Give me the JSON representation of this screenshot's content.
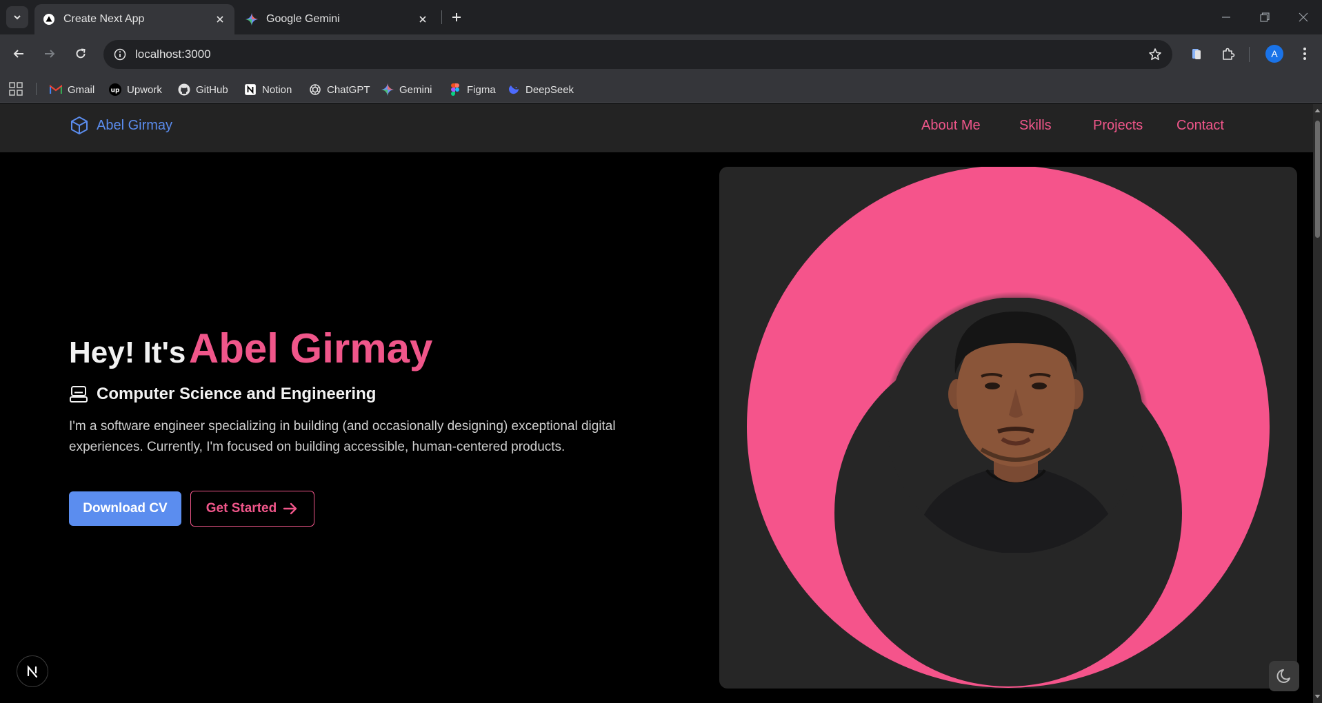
{
  "browser": {
    "tabs": [
      {
        "title": "Create Next App",
        "active": true
      },
      {
        "title": "Google Gemini",
        "active": false
      }
    ],
    "url": "localhost:3000",
    "profile_initial": "A",
    "bookmarks": [
      {
        "label": "Gmail",
        "icon": "gmail-icon"
      },
      {
        "label": "Upwork",
        "icon": "upwork-icon"
      },
      {
        "label": "GitHub",
        "icon": "github-icon"
      },
      {
        "label": "Notion",
        "icon": "notion-icon"
      },
      {
        "label": "ChatGPT",
        "icon": "chatgpt-icon"
      },
      {
        "label": "Gemini",
        "icon": "gemini-icon"
      },
      {
        "label": "Figma",
        "icon": "figma-icon"
      },
      {
        "label": "DeepSeek",
        "icon": "deepseek-icon"
      }
    ]
  },
  "site": {
    "brand": "Abel Girmay",
    "nav": [
      "About Me",
      "Skills",
      "Projects",
      "Contact"
    ],
    "hero": {
      "greeting": "Hey! It's",
      "name": "Abel Girmay",
      "subtitle": "Computer Science and Engineering",
      "description": "I'm a software engineer specializing in building (and occasionally designing) exceptional digital experiences. Currently, I'm focused on building accessible, human-centered products.",
      "primary_button": "Download CV",
      "secondary_button": "Get Started"
    }
  },
  "colors": {
    "accent_pink": "#f0568a",
    "accent_blue": "#5b8def",
    "background": "#000000",
    "card": "#262626"
  }
}
